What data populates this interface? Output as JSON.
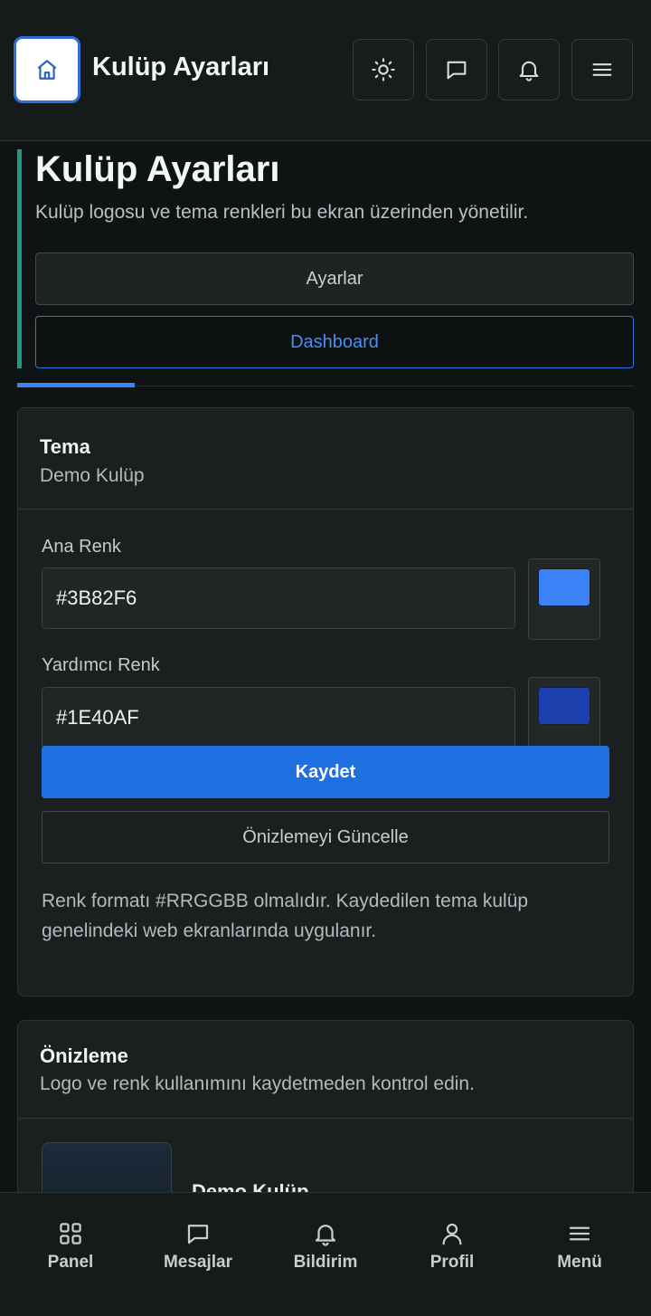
{
  "header": {
    "title": "Kulüp Ayarları",
    "icons": [
      "home-icon",
      "sun-icon",
      "message-icon",
      "bell-icon",
      "menu-icon"
    ]
  },
  "hero": {
    "title": "Kulüp Ayarları",
    "subtitle": "Kulüp logosu ve tema renkleri bu ekran üzerinden yönetilir.",
    "settings_button": "Ayarlar",
    "dashboard_button": "Dashboard",
    "accent_color": "#1f9a86"
  },
  "progress": {
    "fraction": 0.19,
    "color": "#3b82f6"
  },
  "theme_card": {
    "title": "Tema",
    "subtitle": "Demo Kulüp",
    "primary_label": "Ana Renk",
    "primary_value": "#3B82F6",
    "secondary_label": "Yardımcı Renk",
    "secondary_value": "#1E40AF",
    "save_button": "Kaydet",
    "refresh_preview_button": "Önizlemeyi Güncelle",
    "helper_text": "Renk formatı #RRGGBB olmalıdır. Kaydedilen tema kulüp genelindeki web ekranlarında uygulanır."
  },
  "preview_card": {
    "title": "Önizleme",
    "subtitle": "Logo ve renk kullanımını kaydetmeden kontrol edin.",
    "club_name": "Demo Kulüp"
  },
  "bottom_nav": {
    "items": [
      {
        "label": "Panel",
        "icon": "grid-icon"
      },
      {
        "label": "Mesajlar",
        "icon": "message-icon"
      },
      {
        "label": "Bildirim",
        "icon": "bell-icon"
      },
      {
        "label": "Profil",
        "icon": "user-icon"
      },
      {
        "label": "Menü",
        "icon": "menu-icon"
      }
    ]
  }
}
